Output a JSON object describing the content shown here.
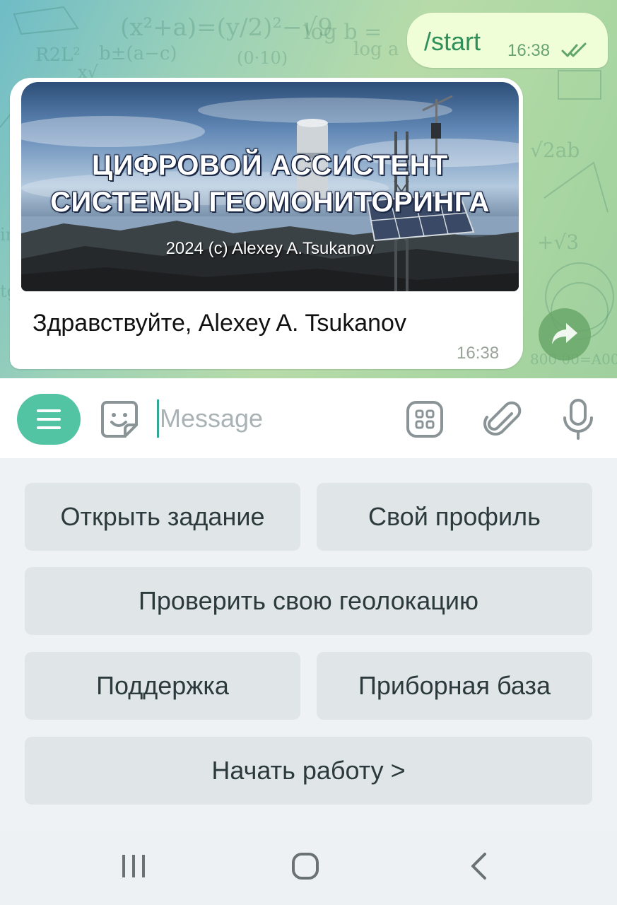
{
  "chat": {
    "outgoing": {
      "text": "/start",
      "time": "16:38",
      "status_icon": "double-check-icon"
    },
    "incoming": {
      "banner": {
        "title_line1": "ЦИФРОВОЙ АССИСТЕНТ",
        "title_line2": "СИСТЕМЫ ГЕОМОНИТОРИНГА",
        "credit": "2024   (c)  Alexey A.Tsukanov"
      },
      "text": "Здравствуйте, Alexey A. Tsukanov",
      "time": "16:38"
    },
    "share_icon": "share-arrow-icon"
  },
  "input_bar": {
    "menu_icon": "menu-icon",
    "emoji_icon": "sticker-icon",
    "placeholder": "Message",
    "value": "",
    "bot_commands_icon": "bot-commands-icon",
    "attach_icon": "paperclip-icon",
    "mic_icon": "microphone-icon"
  },
  "keyboard": {
    "buttons": [
      "Открыть задание",
      "Свой профиль",
      "Проверить свою геолокацию",
      "Поддержка",
      "Приборная база",
      "Начать работу >"
    ]
  },
  "navbar": {
    "recent_icon": "recent-apps-icon",
    "home_icon": "home-icon",
    "back_icon": "back-icon"
  },
  "colors": {
    "accent": "#52c4a4",
    "outgoing_bubble": "#effed6",
    "keyboard_bg": "#eef2f4",
    "keyboard_button": "#e0e6e8"
  }
}
